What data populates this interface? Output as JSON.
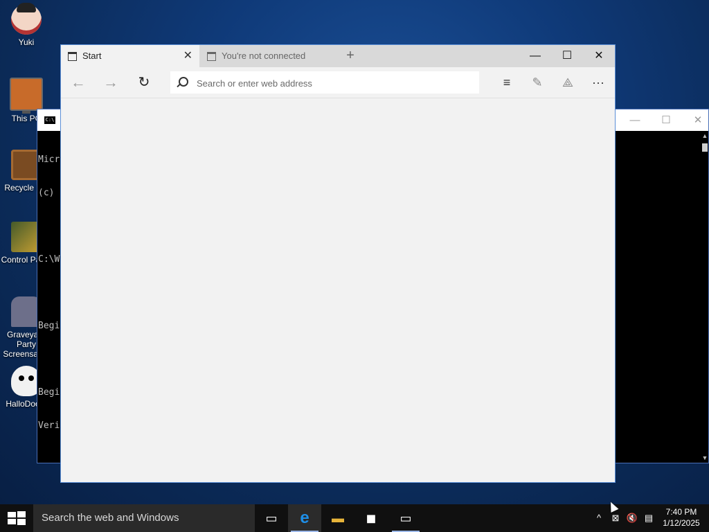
{
  "desktop": {
    "icons": [
      {
        "label": "Yuki",
        "icon": "vampire-user-icon"
      },
      {
        "label": "This PC",
        "icon": "computer-icon"
      },
      {
        "label": "Recycle Bin",
        "icon": "recycle-bin-icon"
      },
      {
        "label": "Control Panel",
        "icon": "control-panel-icon"
      },
      {
        "label": "Graveyard Party Screensaver",
        "icon": "graveyard-icon"
      },
      {
        "label": "HalloDoom",
        "icon": "skull-icon"
      }
    ]
  },
  "console": {
    "lines": [
      "Micr",
      "(c)",
      "",
      "C:\\W",
      "",
      "Begi",
      "",
      "Begi",
      "Veri"
    ],
    "minimize": "—",
    "maximize": "☐",
    "close": "✕"
  },
  "edge": {
    "tabs": [
      {
        "label": "Start",
        "close": "✕"
      },
      {
        "label": "You're not connected"
      }
    ],
    "new_tab": "+",
    "window_controls": {
      "minimize": "—",
      "maximize": "☐",
      "close": "✕"
    },
    "toolbar": {
      "back": "←",
      "forward": "→",
      "refresh": "↻",
      "hub": "≡",
      "web_note": "✎",
      "share": "⟁",
      "more": "···"
    },
    "address_bar": {
      "placeholder": "Search or enter web address",
      "value": ""
    }
  },
  "taskbar": {
    "search_placeholder": "Search the web and Windows",
    "apps": [
      {
        "name": "task-view",
        "glyph": "▭"
      },
      {
        "name": "edge",
        "glyph": "e"
      },
      {
        "name": "file-explorer",
        "glyph": "▬"
      },
      {
        "name": "store",
        "glyph": "◼"
      },
      {
        "name": "command-prompt",
        "glyph": "▭"
      }
    ],
    "tray": {
      "chevron": "^",
      "network": "⊠",
      "volume": "🔇",
      "notifications": "▤"
    },
    "time": "7:40 PM",
    "date": "1/12/2025"
  },
  "colors": {
    "edge_accent": "#1e6fd0",
    "window_border": "#5b8fd7",
    "taskbar": "#101010"
  }
}
